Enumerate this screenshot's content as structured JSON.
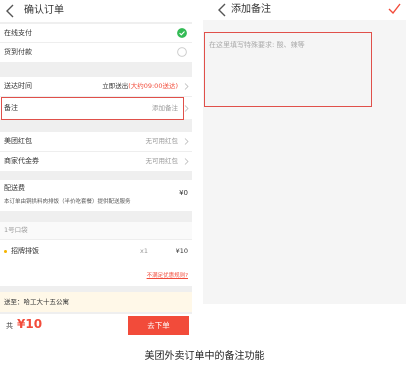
{
  "left": {
    "nav": {
      "title": "确认订单"
    },
    "payment": {
      "online": "在线支付",
      "cod": "货到付款"
    },
    "delivery": {
      "label": "送达时间",
      "value_main": "立即送出",
      "value_eta": "(大约09:00送达)"
    },
    "note": {
      "label": "备注",
      "value": "添加备注"
    },
    "coupons": [
      {
        "label": "美团红包",
        "value": "无可用红包"
      },
      {
        "label": "商家代金券",
        "value": "无可用红包"
      }
    ],
    "delivery_fee": {
      "label": "配送费",
      "value": "¥0",
      "desc": "本订单由铜拱料肉排饭（半价吃套餐）提供配送服务"
    },
    "bag": {
      "label": "1号口袋"
    },
    "item": {
      "name": "招牌排饭",
      "qty": "x1",
      "price": "¥10"
    },
    "link": "不满足优惠规则?",
    "address": {
      "text": "送至：哈工大十五公寓"
    },
    "footer": {
      "total_prefix": "共",
      "total_amount": "¥10",
      "submit": "去下单"
    }
  },
  "right": {
    "nav": {
      "title": "添加备注"
    },
    "note_placeholder": "在这里填写特殊要求: 酸、辣等"
  },
  "caption": "美团外卖订单中的备注功能",
  "colors": {
    "accent": "#f24b3a",
    "check_green": "#33bb55",
    "highlight_border": "#e0504a"
  }
}
